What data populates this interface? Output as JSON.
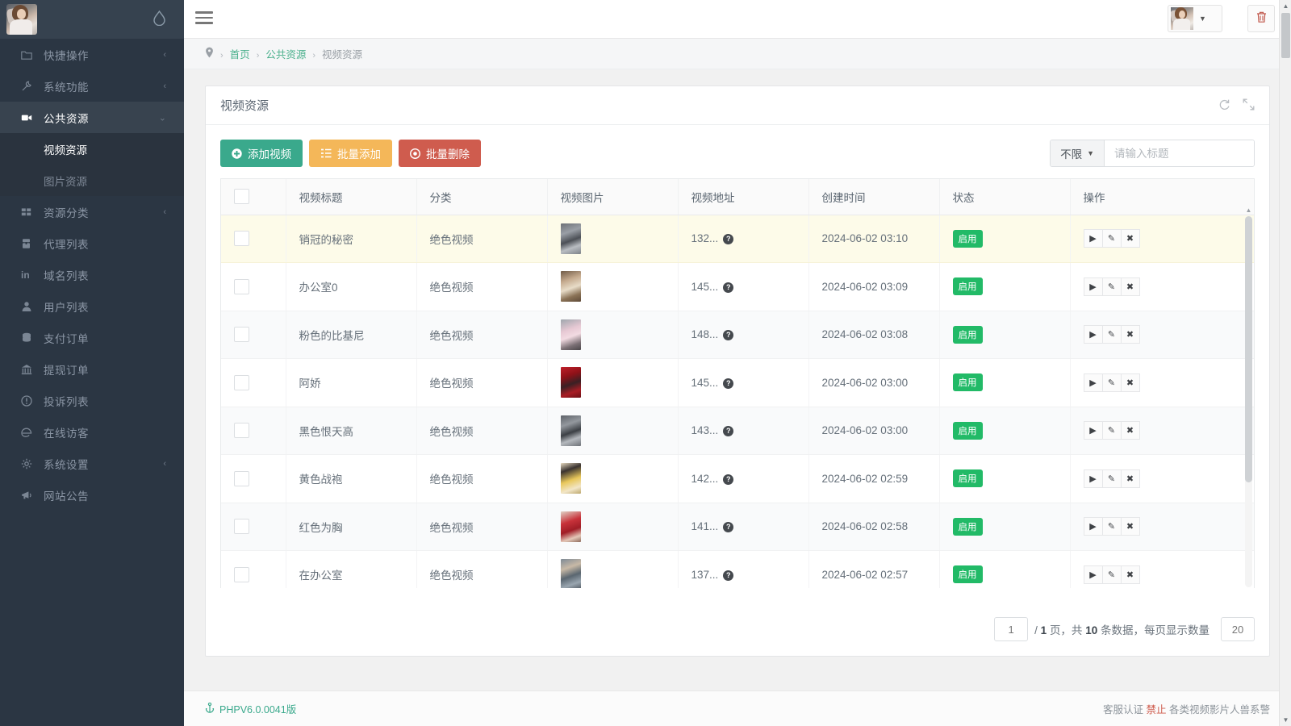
{
  "brand": {
    "drop_icon": "water-drop-icon"
  },
  "sidebar": {
    "items": [
      {
        "label": "快捷操作",
        "icon": "folder-icon",
        "caret": "‹",
        "active": false
      },
      {
        "label": "系统功能",
        "icon": "wrench-icon",
        "caret": "‹",
        "active": false
      },
      {
        "label": "公共资源",
        "icon": "video-camera-icon",
        "caret": "⌄",
        "active": true
      },
      {
        "label": "资源分类",
        "icon": "grid-icon",
        "caret": "‹",
        "active": false
      },
      {
        "label": "代理列表",
        "icon": "agent-icon",
        "caret": "",
        "active": false
      },
      {
        "label": "域名列表",
        "icon": "linkedin-icon",
        "caret": "",
        "active": false
      },
      {
        "label": "用户列表",
        "icon": "user-icon",
        "caret": "",
        "active": false
      },
      {
        "label": "支付订单",
        "icon": "database-icon",
        "caret": "",
        "active": false
      },
      {
        "label": "提现订单",
        "icon": "bank-icon",
        "caret": "",
        "active": false
      },
      {
        "label": "投诉列表",
        "icon": "exclamation-circle-icon",
        "caret": "",
        "active": false
      },
      {
        "label": "在线访客",
        "icon": "edge-icon",
        "caret": "",
        "active": false
      },
      {
        "label": "系统设置",
        "icon": "gear-icon",
        "caret": "‹",
        "active": false
      },
      {
        "label": "网站公告",
        "icon": "megaphone-icon",
        "caret": "",
        "active": false
      }
    ],
    "submenu": [
      {
        "label": "视频资源",
        "current": true
      },
      {
        "label": "图片资源",
        "current": false
      }
    ]
  },
  "topbar": {
    "menu_icon": "hamburger-icon",
    "user_caret": "▼",
    "trash_icon": "trash-icon"
  },
  "breadcrumb": {
    "pin_icon": "location-pin-icon",
    "sep": "›",
    "items": [
      {
        "label": "首页",
        "current": false
      },
      {
        "label": "公共资源",
        "current": false
      },
      {
        "label": "视频资源",
        "current": true
      }
    ]
  },
  "panel": {
    "title": "视频资源",
    "refresh_icon": "refresh-icon",
    "expand_icon": "expand-icon"
  },
  "toolbar": {
    "add_label": "添加视频",
    "add_icon": "plus-circle-icon",
    "batch_add_label": "批量添加",
    "batch_add_icon": "list-icon",
    "batch_delete_label": "批量删除",
    "batch_delete_icon": "ban-circle-icon"
  },
  "search": {
    "select_value": "不限",
    "select_caret": "▼",
    "placeholder": "请输入标题",
    "value": ""
  },
  "table": {
    "columns": [
      "",
      "视频标题",
      "分类",
      "视频图片",
      "视频地址",
      "创建时间",
      "状态",
      "操作"
    ],
    "rows": [
      {
        "title": "销冠的秘密",
        "category": "绝色视频",
        "address": "132...",
        "created": "2024-06-02 03:10",
        "status": "启用",
        "thumb": "linear-gradient(160deg,#6d7076 0%,#9a9fa6 30%,#4c5056 55%,#b9bdc2 75%,#7d8288 100%)"
      },
      {
        "title": "办公室0",
        "category": "绝色视频",
        "address": "145...",
        "created": "2024-06-02 03:09",
        "status": "启用",
        "thumb": "linear-gradient(160deg,#6f5a46 0%,#c4a98d 30%,#e8dcc8 55%,#8a7256 78%,#5e4a38 100%)"
      },
      {
        "title": "粉色的比基尼",
        "category": "绝色视频",
        "address": "148...",
        "created": "2024-06-02 03:08",
        "status": "启用",
        "thumb": "linear-gradient(160deg,#9fa6ad 0%,#e7c9d4 35%,#f2dbe2 55%,#7a6f74 80%,#4a4548 100%)"
      },
      {
        "title": "阿娇",
        "category": "绝色视频",
        "address": "145...",
        "created": "2024-06-02 03:00",
        "status": "启用",
        "thumb": "linear-gradient(160deg,#c0202a 0%,#8f1118 30%,#3a2024 55%,#a81d25 78%,#6b1016 100%)"
      },
      {
        "title": "黑色恨天高",
        "category": "绝色视频",
        "address": "143...",
        "created": "2024-06-02 03:00",
        "status": "启用",
        "thumb": "linear-gradient(160deg,#5e6268 0%,#93989e 30%,#3c4045 55%,#b4b8bd 75%,#6e7278 100%)"
      },
      {
        "title": "黄色战袍",
        "category": "绝色视频",
        "address": "142...",
        "created": "2024-06-02 02:59",
        "status": "启用",
        "thumb": "linear-gradient(160deg,#e6d9c0 0%,#3a3330 25%,#e8c75a 55%,#f2e6c8 80%,#bda86e 100%)"
      },
      {
        "title": "红色为胸",
        "category": "绝色视频",
        "address": "141...",
        "created": "2024-06-02 02:58",
        "status": "启用",
        "thumb": "linear-gradient(160deg,#e0d2c6 0%,#c8323a 35%,#a01d26 60%,#e4c8b8 82%,#8d6a5c 100%)"
      },
      {
        "title": "在办公室",
        "category": "绝色视频",
        "address": "137...",
        "created": "2024-06-02 02:57",
        "status": "启用",
        "thumb": "linear-gradient(160deg,#7e8a95 0%,#c8b9a6 30%,#5a6670 55%,#9aa6b0 78%,#4e565e 100%)"
      }
    ],
    "row_ops": [
      {
        "icon": "play-icon",
        "glyph": "▶"
      },
      {
        "icon": "edit-pencil-icon",
        "glyph": "✎"
      },
      {
        "icon": "close-x-icon",
        "glyph": "✖"
      }
    ],
    "help_icon": "question-circle-icon",
    "scroll_up_icon": "caret-up-icon",
    "scroll_down_icon": "caret-down-icon"
  },
  "pagination": {
    "current_page": "1",
    "text_before": "/",
    "total_pages": "1",
    "unit_page": "页，共",
    "total_records": "10",
    "unit_records": "条数据，每页显示数量",
    "page_size": "20"
  },
  "footer": {
    "left_icon": "anchor-icon",
    "left_text": "PHPV6.0.0041版",
    "right_prefix": "客服认证",
    "right_warn": "禁止",
    "right_text": "各类视频影片人兽系警"
  },
  "colors": {
    "sidebar_bg": "#2b3643",
    "accent_green": "#3aa98c",
    "status_green": "#22ba67",
    "warn_orange": "#f4b759",
    "danger_red": "#cf5c4e",
    "hover_row": "#fdfbe9"
  }
}
